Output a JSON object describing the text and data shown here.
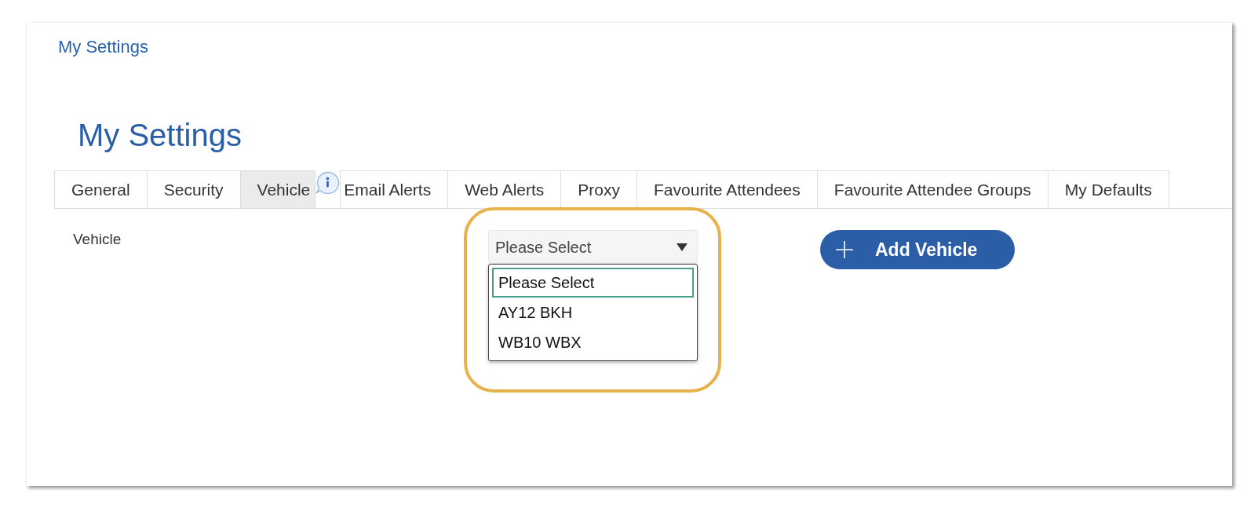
{
  "breadcrumb": "My Settings",
  "title": "My Settings",
  "tabs": [
    {
      "label": "General",
      "selected": false
    },
    {
      "label": "Security",
      "selected": false
    },
    {
      "label": "Vehicle",
      "selected": true
    },
    {
      "label": "Email Alerts",
      "selected": false
    },
    {
      "label": "Web Alerts",
      "selected": false
    },
    {
      "label": "Proxy",
      "selected": false
    },
    {
      "label": "Favourite Attendees",
      "selected": false
    },
    {
      "label": "Favourite Attendee Groups",
      "selected": false
    },
    {
      "label": "My Defaults",
      "selected": false
    }
  ],
  "vehicle": {
    "label": "Vehicle",
    "select": {
      "value": "Please Select",
      "expanded": true,
      "options": [
        {
          "label": "Please Select",
          "selected": true
        },
        {
          "label": "AY12 BKH",
          "selected": false
        },
        {
          "label": "WB10 WBX",
          "selected": false
        }
      ]
    }
  },
  "add_button": {
    "label": "Add Vehicle"
  }
}
